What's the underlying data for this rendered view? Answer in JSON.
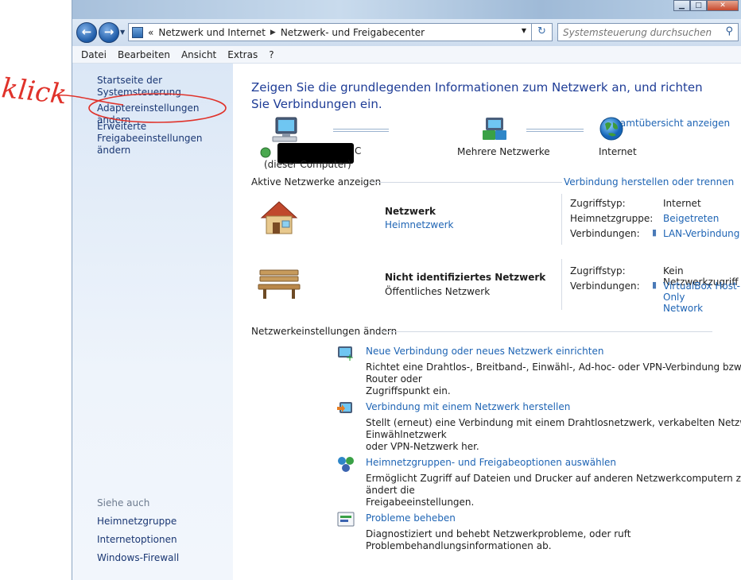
{
  "annotation": {
    "handwritten": "klick"
  },
  "window": {
    "minimize": "▁",
    "maximize": "□",
    "close": "✕"
  },
  "nav": {
    "breadcrumbs": [
      "«",
      "Netzwerk und Internet",
      "Netzwerk- und Freigabecenter"
    ],
    "search_placeholder": "Systemsteuerung durchsuchen"
  },
  "menu": [
    "Datei",
    "Bearbeiten",
    "Ansicht",
    "Extras",
    "?"
  ],
  "sidebar": {
    "home": "Startseite der Systemsteuerung",
    "adapter": "Adaptereinstellungen ändern",
    "advanced_1": "Erweiterte",
    "advanced_2": "Freigabeeinstellungen ändern",
    "see_also": "Siehe auch",
    "links": [
      "Heimnetzgruppe",
      "Internetoptionen",
      "Windows-Firewall"
    ]
  },
  "main": {
    "title": "Zeigen Sie die grundlegenden Informationen zum Netzwerk an, und richten Sie Verbindungen ein.",
    "overview_link": "Gesamtübersicht anzeigen",
    "map": {
      "computer_suffix": "C",
      "computer_note": "(dieser Computer)",
      "middle": "Mehrere Netzwerke",
      "internet": "Internet"
    },
    "active_header": "Aktive Netzwerke anzeigen",
    "connect_link": "Verbindung herstellen oder trennen",
    "networks": [
      {
        "name": "Netzwerk",
        "type": "Heimnetzwerk",
        "props": [
          {
            "k": "Zugriffstyp:",
            "v": "Internet"
          },
          {
            "k": "Heimnetzgruppe:",
            "v": "Beigetreten"
          },
          {
            "k": "Verbindungen:",
            "v": "LAN-Verbindung"
          }
        ]
      },
      {
        "name": "Nicht identifiziertes Netzwerk",
        "type": "Öffentliches Netzwerk",
        "props": [
          {
            "k": "Zugriffstyp:",
            "v": "Kein Netzwerkzugriff"
          },
          {
            "k": "Verbindungen:",
            "v": "VirtualBox Host-Only",
            "v2": "Network"
          }
        ]
      }
    ],
    "settings_header": "Netzwerkeinstellungen ändern",
    "tasks": [
      {
        "link": "Neue Verbindung oder neues Netzwerk einrichten",
        "desc": [
          "Richtet eine Drahtlos-, Breitband-, Einwähl-, Ad-hoc- oder VPN-Verbindung bzw. einen Router oder",
          "Zugriffspunkt ein."
        ]
      },
      {
        "link": "Verbindung mit einem Netzwerk herstellen",
        "desc": [
          "Stellt (erneut) eine Verbindung mit einem Drahtlosnetzwerk, verkabelten Netzwerk, Einwählnetzwerk",
          "oder VPN-Netzwerk her."
        ]
      },
      {
        "link": "Heimnetzgruppen- und Freigabeoptionen auswählen",
        "desc": [
          "Ermöglicht Zugriff auf Dateien und Drucker auf anderen Netzwerkcomputern zu, oder ändert die",
          "Freigabeeinstellungen."
        ]
      },
      {
        "link": "Probleme beheben",
        "desc": [
          "Diagnostiziert und behebt Netzwerkprobleme, oder ruft Problembehandlungsinformationen ab."
        ]
      }
    ]
  }
}
